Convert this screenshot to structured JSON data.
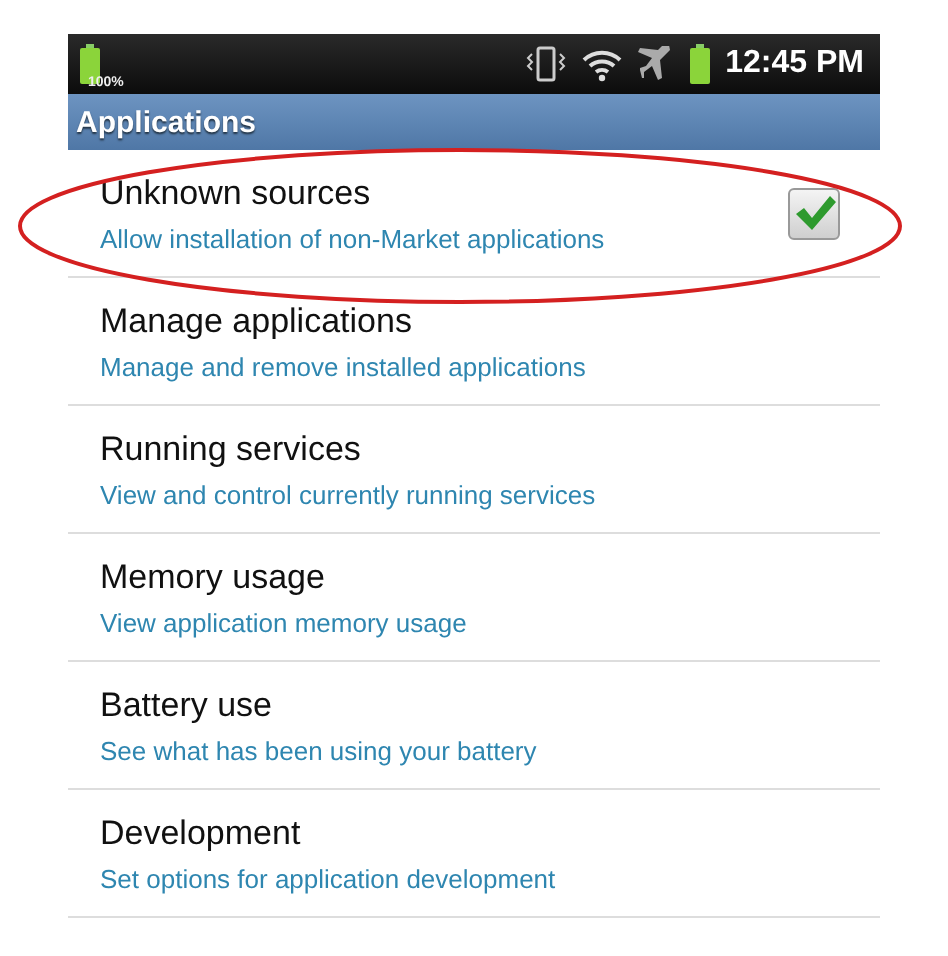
{
  "status_bar": {
    "battery_percent": "100%",
    "time": "12:45 PM"
  },
  "title_bar": {
    "title": "Applications"
  },
  "items": [
    {
      "kind": "checkbox",
      "title": "Unknown sources",
      "summary": "Allow installation of non-Market applications",
      "checked": true,
      "highlighted": true
    },
    {
      "kind": "plain",
      "title": "Manage applications",
      "summary": "Manage and remove installed applications"
    },
    {
      "kind": "plain",
      "title": "Running services",
      "summary": "View and control currently running services"
    },
    {
      "kind": "plain",
      "title": "Memory usage",
      "summary": "View application memory usage"
    },
    {
      "kind": "plain",
      "title": "Battery use",
      "summary": "See what has been using your battery"
    },
    {
      "kind": "plain",
      "title": "Development",
      "summary": "Set options for application development"
    }
  ]
}
